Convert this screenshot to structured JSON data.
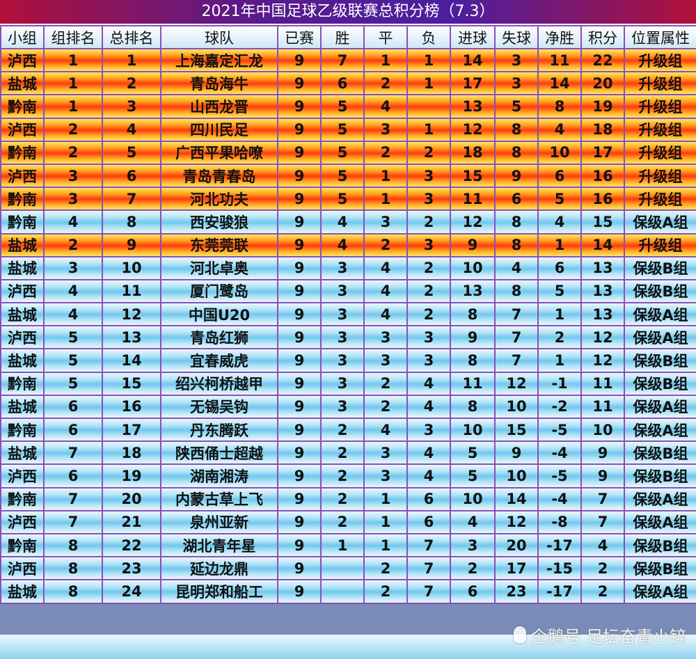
{
  "title": "2021年中国足球乙级联赛总积分榜（7.3）",
  "headers": [
    "小组",
    "组排名",
    "总排名",
    "球队",
    "已赛",
    "胜",
    "平",
    "负",
    "进球",
    "失球",
    "净胜",
    "积分",
    "位置属性"
  ],
  "rows": [
    {
      "style": "promo",
      "cells": [
        "泸西",
        "1",
        "1",
        "上海嘉定汇龙",
        "9",
        "7",
        "1",
        "1",
        "14",
        "3",
        "11",
        "22",
        "升级组"
      ]
    },
    {
      "style": "promo",
      "cells": [
        "盐城",
        "1",
        "2",
        "青岛海牛",
        "9",
        "6",
        "2",
        "1",
        "17",
        "3",
        "14",
        "20",
        "升级组"
      ]
    },
    {
      "style": "promo",
      "cells": [
        "黔南",
        "1",
        "3",
        "山西龙晋",
        "9",
        "5",
        "4",
        "",
        "13",
        "5",
        "8",
        "19",
        "升级组"
      ]
    },
    {
      "style": "promo",
      "cells": [
        "泸西",
        "2",
        "4",
        "四川民足",
        "9",
        "5",
        "3",
        "1",
        "12",
        "8",
        "4",
        "18",
        "升级组"
      ]
    },
    {
      "style": "promo",
      "cells": [
        "黔南",
        "2",
        "5",
        "广西平果哈嘹",
        "9",
        "5",
        "2",
        "2",
        "18",
        "8",
        "10",
        "17",
        "升级组"
      ]
    },
    {
      "style": "promo",
      "cells": [
        "泸西",
        "3",
        "6",
        "青岛青春岛",
        "9",
        "5",
        "1",
        "3",
        "15",
        "9",
        "6",
        "16",
        "升级组"
      ]
    },
    {
      "style": "promo",
      "cells": [
        "黔南",
        "3",
        "7",
        "河北功夫",
        "9",
        "5",
        "1",
        "3",
        "11",
        "6",
        "5",
        "16",
        "升级组"
      ]
    },
    {
      "style": "safe",
      "cells": [
        "黔南",
        "4",
        "8",
        "西安骏狼",
        "9",
        "4",
        "3",
        "2",
        "12",
        "8",
        "4",
        "15",
        "保级A组"
      ]
    },
    {
      "style": "promo",
      "cells": [
        "盐城",
        "2",
        "9",
        "东莞莞联",
        "9",
        "4",
        "2",
        "3",
        "9",
        "8",
        "1",
        "14",
        "升级组"
      ]
    },
    {
      "style": "safe",
      "cells": [
        "盐城",
        "3",
        "10",
        "河北卓奥",
        "9",
        "3",
        "4",
        "2",
        "10",
        "4",
        "6",
        "13",
        "保级B组"
      ]
    },
    {
      "style": "safe",
      "cells": [
        "泸西",
        "4",
        "11",
        "厦门鹭岛",
        "9",
        "3",
        "4",
        "2",
        "13",
        "8",
        "5",
        "13",
        "保级B组"
      ]
    },
    {
      "style": "safe",
      "cells": [
        "盐城",
        "4",
        "12",
        "中国U20",
        "9",
        "3",
        "4",
        "2",
        "8",
        "7",
        "1",
        "13",
        "保级A组"
      ]
    },
    {
      "style": "safe",
      "cells": [
        "泸西",
        "5",
        "13",
        "青岛红狮",
        "9",
        "3",
        "3",
        "3",
        "9",
        "7",
        "2",
        "12",
        "保级A组"
      ]
    },
    {
      "style": "safe",
      "cells": [
        "盐城",
        "5",
        "14",
        "宜春威虎",
        "9",
        "3",
        "3",
        "3",
        "8",
        "7",
        "1",
        "12",
        "保级B组"
      ]
    },
    {
      "style": "safe",
      "cells": [
        "黔南",
        "5",
        "15",
        "绍兴柯桥越甲",
        "9",
        "3",
        "2",
        "4",
        "11",
        "12",
        "-1",
        "11",
        "保级B组"
      ]
    },
    {
      "style": "safe",
      "cells": [
        "盐城",
        "6",
        "16",
        "无锡吴钩",
        "9",
        "3",
        "2",
        "4",
        "8",
        "10",
        "-2",
        "11",
        "保级A组"
      ]
    },
    {
      "style": "safe",
      "cells": [
        "黔南",
        "6",
        "17",
        "丹东腾跃",
        "9",
        "2",
        "4",
        "3",
        "10",
        "15",
        "-5",
        "10",
        "保级A组"
      ]
    },
    {
      "style": "safe",
      "cells": [
        "盐城",
        "7",
        "18",
        "陕西俑士超越",
        "9",
        "2",
        "3",
        "4",
        "5",
        "9",
        "-4",
        "9",
        "保级B组"
      ]
    },
    {
      "style": "safe",
      "cells": [
        "泸西",
        "6",
        "19",
        "湖南湘涛",
        "9",
        "2",
        "3",
        "4",
        "5",
        "10",
        "-5",
        "9",
        "保级B组"
      ]
    },
    {
      "style": "safe",
      "cells": [
        "黔南",
        "7",
        "20",
        "内蒙古草上飞",
        "9",
        "2",
        "1",
        "6",
        "10",
        "14",
        "-4",
        "7",
        "保级A组"
      ]
    },
    {
      "style": "safe",
      "cells": [
        "泸西",
        "7",
        "21",
        "泉州亚新",
        "9",
        "2",
        "1",
        "6",
        "4",
        "12",
        "-8",
        "7",
        "保级A组"
      ]
    },
    {
      "style": "safe",
      "cells": [
        "黔南",
        "8",
        "22",
        "湖北青年星",
        "9",
        "1",
        "1",
        "7",
        "3",
        "20",
        "-17",
        "4",
        "保级B组"
      ]
    },
    {
      "style": "safe",
      "cells": [
        "泸西",
        "8",
        "23",
        "延边龙鼎",
        "9",
        "",
        "2",
        "7",
        "2",
        "17",
        "-15",
        "2",
        "保级B组"
      ]
    },
    {
      "style": "safe",
      "cells": [
        "盐城",
        "8",
        "24",
        "昆明郑和船工",
        "9",
        "",
        "2",
        "7",
        "6",
        "23",
        "-17",
        "2",
        "保级A组"
      ]
    }
  ],
  "watermark": {
    "icon": "penguin-icon",
    "text": "企鹅号 足坛奋青小锌"
  }
}
